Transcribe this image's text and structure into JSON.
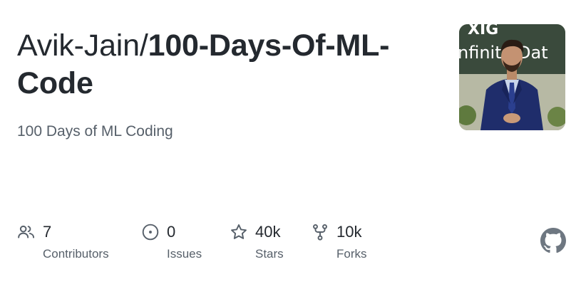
{
  "repo": {
    "owner": "Avik-Jain/",
    "name": "100-Days-Of-ML-Code",
    "description": "100 Days of ML Coding"
  },
  "avatar": {
    "banner_text_top": "XIG",
    "banner_text": "nfinite Dat"
  },
  "stats": {
    "contributors": {
      "value": "7",
      "label": "Contributors",
      "icon": "people-icon"
    },
    "issues": {
      "value": "0",
      "label": "Issues",
      "icon": "issue-opened-icon"
    },
    "stars": {
      "value": "40k",
      "label": "Stars",
      "icon": "star-icon"
    },
    "forks": {
      "value": "10k",
      "label": "Forks",
      "icon": "repo-forked-icon"
    }
  },
  "colors": {
    "text_primary": "#24292f",
    "text_secondary": "#57606a",
    "icon_gray": "#57606a",
    "github_logo": "#6e7781"
  }
}
